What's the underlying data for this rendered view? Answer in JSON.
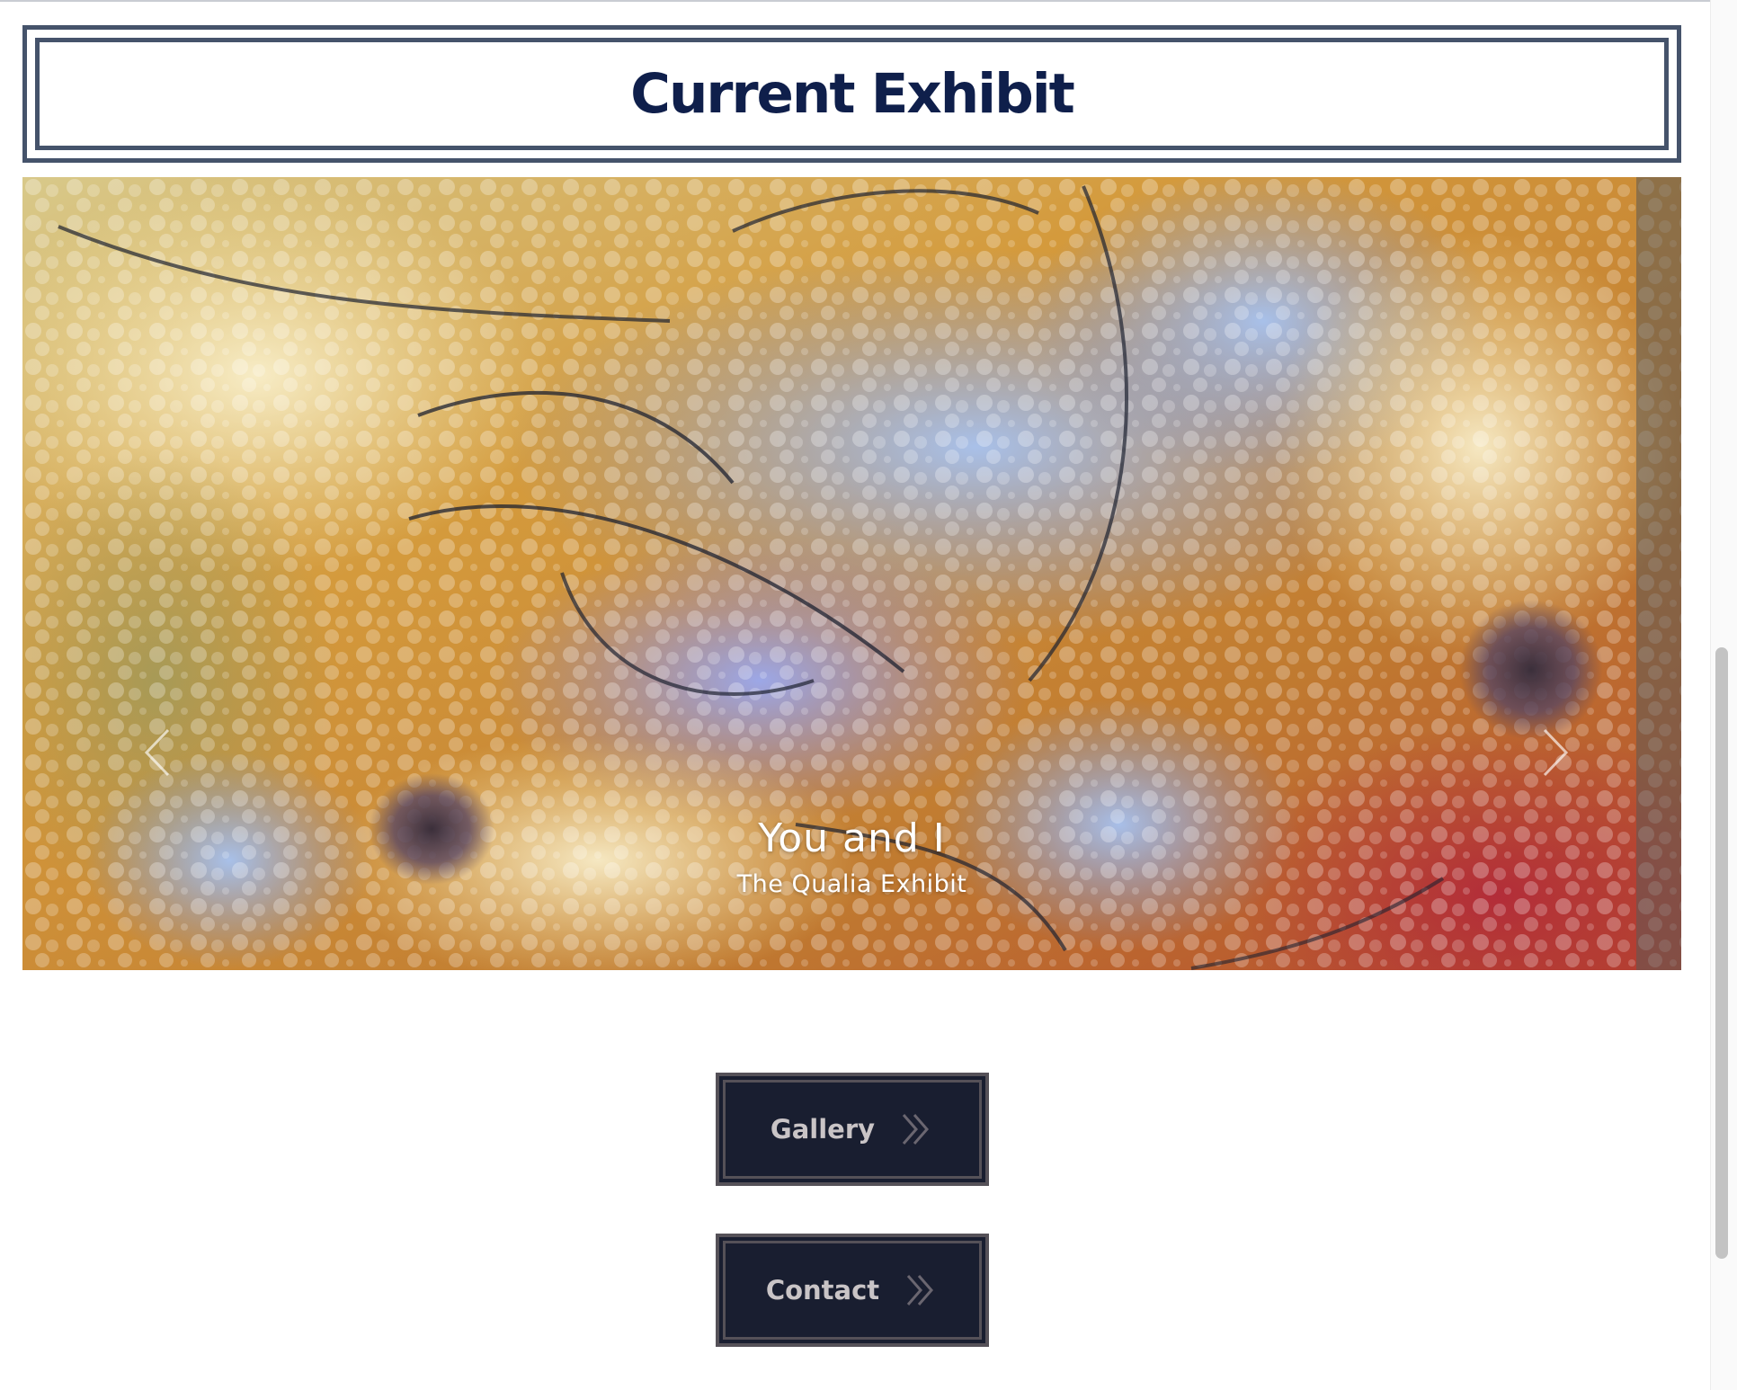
{
  "heading": {
    "title": "Current Exhibit"
  },
  "carousel": {
    "slide_title": "You and I",
    "slide_subtitle": "The Qualia Exhibit",
    "prev_icon": "chevron-left-icon",
    "next_icon": "chevron-right-icon"
  },
  "buttons": {
    "gallery_label": "Gallery",
    "contact_label": "Contact",
    "icon": "double-chevron-right-icon"
  },
  "colors": {
    "heading_text": "#0f1f4b",
    "heading_border": "#45536b",
    "button_bg": "#191e30",
    "button_border": "#555158",
    "button_text": "#c9c4c6"
  }
}
